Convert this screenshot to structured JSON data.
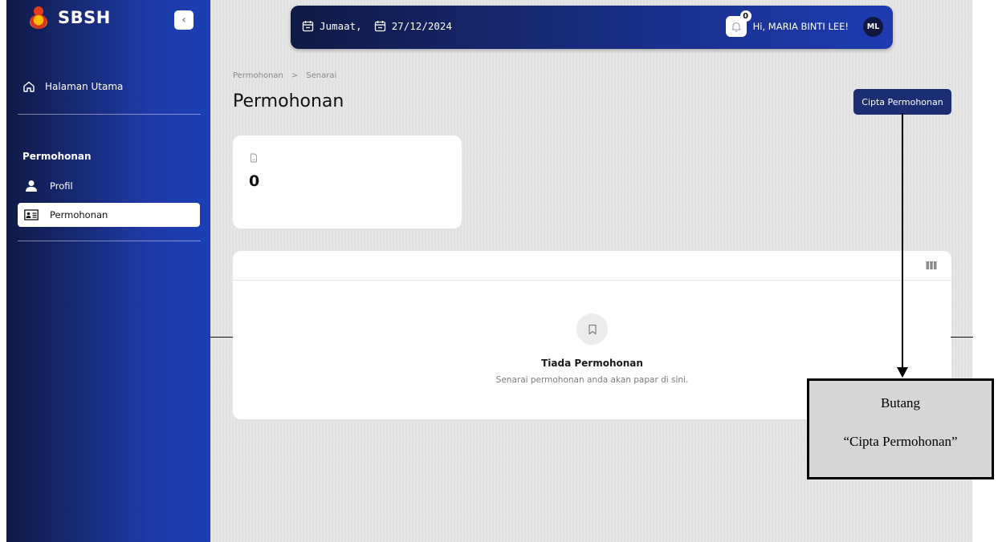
{
  "sidebar": {
    "brand": "SBSH",
    "collapse_icon": "chevron-left-icon",
    "home_label": "Halaman Utama",
    "section_label": "Permohonan",
    "items": [
      {
        "label": "Profil",
        "icon": "user-icon",
        "active": false
      },
      {
        "label": "Permohonan",
        "icon": "id-card-icon",
        "active": true
      }
    ]
  },
  "topbar": {
    "day": "Jumaat,",
    "date": "27/12/2024",
    "notification_count": "0",
    "greeting": "Hi, MARIA BINTI LEE!",
    "avatar_initials": "ML"
  },
  "breadcrumb": [
    "Permohonan",
    ">",
    "Senarai"
  ],
  "page_title": "Permohonan",
  "create_button": "Cipta Permohonan",
  "stat": {
    "value": "0",
    "icon": "file-icon"
  },
  "list": {
    "columns_icon": "columns-icon",
    "empty_icon": "bookmark-icon",
    "empty_title": "Tiada Permohonan",
    "empty_description": "Senarai permohonan anda akan papar di sini."
  },
  "annotation": {
    "line1": "Butang",
    "line2": "“Cipta Permohonan”"
  },
  "colors": {
    "sidebar_dark": "#0f1a45",
    "sidebar_blue": "#1c3eb5",
    "primary_button": "#1b2e74",
    "page_background": "#e4e4e4"
  }
}
